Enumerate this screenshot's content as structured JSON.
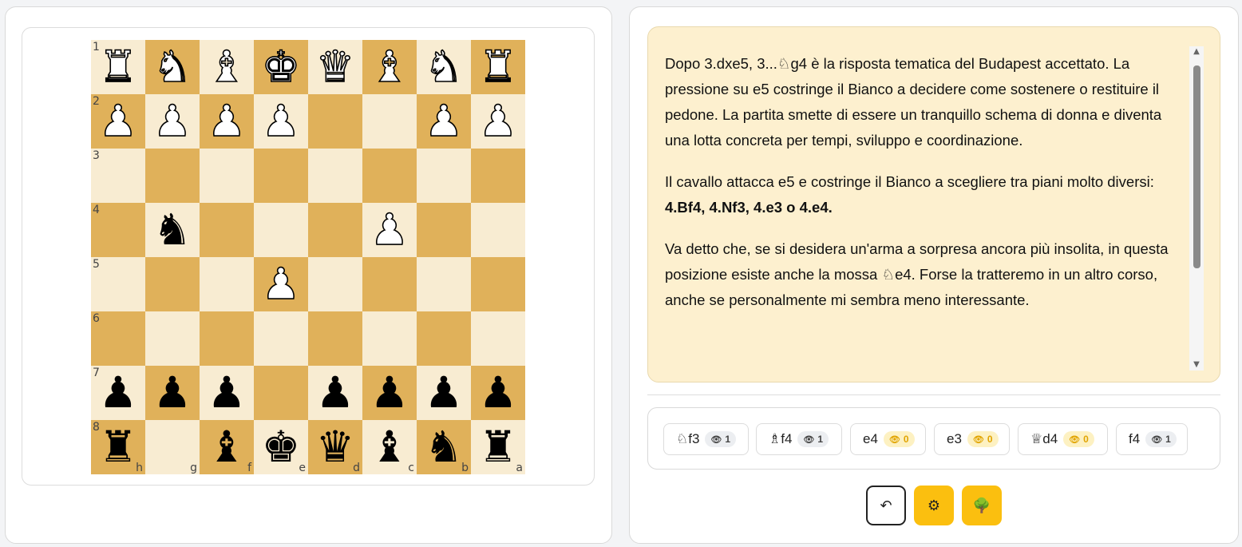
{
  "board": {
    "rows": [
      {
        "rank": "1",
        "squares": [
          "♜w",
          "♞w",
          "♝w",
          "♚w",
          "♛w",
          "♝w",
          "♞w",
          "♜w"
        ]
      },
      {
        "rank": "2",
        "squares": [
          "♟w",
          "♟w",
          "♟w",
          "♟w",
          "",
          "",
          "♟w",
          "♟w"
        ]
      },
      {
        "rank": "3",
        "squares": [
          "",
          "",
          "",
          "",
          "",
          "",
          "",
          ""
        ]
      },
      {
        "rank": "4",
        "squares": [
          "",
          "♞b",
          "",
          "",
          "",
          "♟w",
          "",
          ""
        ]
      },
      {
        "rank": "5",
        "squares": [
          "",
          "",
          "",
          "♟w",
          "",
          "",
          "",
          ""
        ]
      },
      {
        "rank": "6",
        "squares": [
          "",
          "",
          "",
          "",
          "",
          "",
          "",
          ""
        ]
      },
      {
        "rank": "7",
        "squares": [
          "♟b",
          "♟b",
          "♟b",
          "",
          "♟b",
          "♟b",
          "♟b",
          "♟b"
        ]
      },
      {
        "rank": "8",
        "squares": [
          "♜b",
          "",
          "♝b",
          "♚b",
          "♛b",
          "♝b",
          "♞b",
          "♜b"
        ]
      }
    ],
    "files": [
      "h",
      "g",
      "f",
      "e",
      "d",
      "c",
      "b",
      "a"
    ],
    "light_color": "#f8ecd2",
    "dark_color": "#e0b15a"
  },
  "notes": {
    "p1": "Dopo 3.dxe5, 3...♘g4 è la risposta tematica del Budapest accettato. La pressione su e5 costringe il Bianco a decidere come sostenere o restituire il pedone. La partita smette di essere un tranquillo schema di donna e diventa una lotta concreta per tempi, sviluppo e coordinazione.",
    "p2_pre": "Il cavallo attacca e5 e costringe il Bianco a scegliere tra piani molto diversi: ",
    "p2_bold": "4.Bf4, 4.Nf3, 4.e3 o 4.e4.",
    "p3": "Va detto che, se si desidera un'arma a sorpresa ancora più insolita, in questa posizione esiste anche la mossa ♘e4. Forse la tratteremo in un altro corso, anche se personalmente mi sembra meno interessante.",
    "background": "#fdf0cf"
  },
  "moves": [
    {
      "label": "♘f3",
      "count": "1",
      "style": "grey"
    },
    {
      "label": "♗f4",
      "count": "1",
      "style": "grey"
    },
    {
      "label": "e4",
      "count": "0",
      "style": "yellow"
    },
    {
      "label": "e3",
      "count": "0",
      "style": "yellow"
    },
    {
      "label": "♕d4",
      "count": "0",
      "style": "yellow"
    },
    {
      "label": "f4",
      "count": "1",
      "style": "grey"
    }
  ],
  "actions": {
    "undo_icon": "↶",
    "settings_icon": "⚙",
    "tree_icon": "🌳",
    "accent": "#fbbf0f"
  }
}
